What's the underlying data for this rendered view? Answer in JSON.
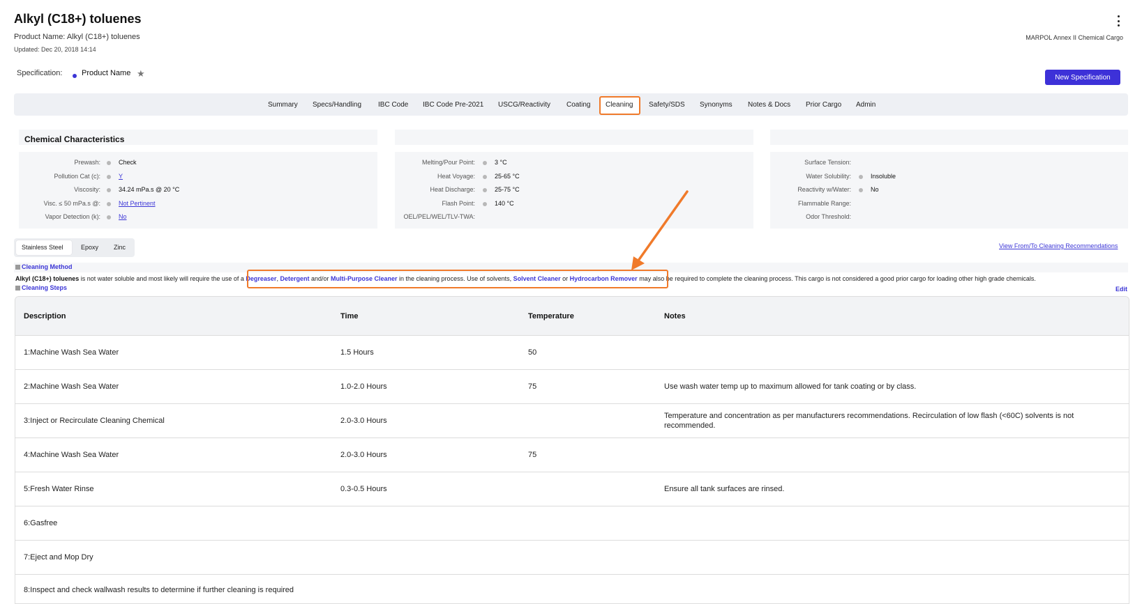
{
  "header": {
    "title": "Alkyl (C18+) toluenes",
    "product_name": "Product Name: Alkyl (C18+) toluenes",
    "updated": "Updated: Dec 20, 2018 14:14",
    "category": "MARPOL Annex II Chemical Cargo"
  },
  "specification": {
    "label": "Specification:",
    "value": "Product Name",
    "new_button": "New Specification"
  },
  "tabs": [
    "Summary",
    "Specs/Handling",
    "IBC Code",
    "IBC Code Pre-2021",
    "USCG/Reactivity",
    "Coating",
    "Cleaning",
    "Safety/SDS",
    "Synonyms",
    "Notes & Docs",
    "Prior Cargo",
    "Admin"
  ],
  "active_tab": "Cleaning",
  "chem": {
    "title": "Chemical Characteristics",
    "col1": [
      {
        "label": "Prewash:",
        "value": "Check",
        "link": false
      },
      {
        "label": "Pollution Cat (c):",
        "value": "Y",
        "link": true
      },
      {
        "label": "Viscosity:",
        "value": "34.24 mPa.s @ 20 °C",
        "link": false
      },
      {
        "label": "Visc. ≤ 50 mPa.s @:",
        "value": "Not Pertinent",
        "link": true
      },
      {
        "label": "Vapor Detection (k):",
        "value": "No",
        "link": true
      }
    ],
    "col2": [
      {
        "label": "Melting/Pour Point:",
        "value": "3 °C"
      },
      {
        "label": "Heat Voyage:",
        "value": "25-65 °C"
      },
      {
        "label": "Heat Discharge:",
        "value": "25-75 °C"
      },
      {
        "label": "Flash Point:",
        "value": "140 °C"
      },
      {
        "label": "OEL/PEL/WEL/TLV-TWA:",
        "value": ""
      }
    ],
    "col3": [
      {
        "label": "Surface Tension:",
        "value": ""
      },
      {
        "label": "Water Solubility:",
        "value": "Insoluble"
      },
      {
        "label": "Reactivity w/Water:",
        "value": "No"
      },
      {
        "label": "Flammable Range:",
        "value": ""
      },
      {
        "label": "Odor Threshold:",
        "value": ""
      }
    ]
  },
  "materials": {
    "tabs": [
      "Stainless Steel",
      "Epoxy",
      "Zinc"
    ],
    "active": "Stainless Steel",
    "view_link": "View From/To Cleaning Recommendations"
  },
  "cleaning_method": {
    "title": "Cleaning Method",
    "product": "Alkyl (C18+) toluenes",
    "t1": " is not water soluble and most likely will require the use of a ",
    "l1": "Degreaser",
    "t2": ", ",
    "l2": "Detergent",
    "t3": " and/or ",
    "l3": "Multi-Purpose Cleaner",
    "t4": " in the cleaning process. Use of solvents, ",
    "l4": "Solvent Cleaner",
    "t5": " or ",
    "l5": "Hydrocarbon Remover",
    "t6": " may also be required to complete the cleaning process. This cargo is not considered a good prior cargo for loading other high grade chemicals."
  },
  "cleaning_steps": {
    "title": "Cleaning Steps",
    "edit": "Edit",
    "headers": {
      "description": "Description",
      "time": "Time",
      "temperature": "Temperature",
      "notes": "Notes"
    },
    "rows": [
      {
        "description": "1:Machine Wash Sea Water",
        "time": "1.5 Hours",
        "temperature": "50",
        "notes": ""
      },
      {
        "description": "2:Machine Wash Sea Water",
        "time": "1.0-2.0 Hours",
        "temperature": "75",
        "notes": "Use wash water temp up to maximum allowed for tank coating or by class."
      },
      {
        "description": "3:Inject or Recirculate Cleaning Chemical",
        "time": "2.0-3.0 Hours",
        "temperature": "",
        "notes": "Temperature and concentration as per manufacturers recommendations. Recirculation of low flash (<60C) solvents is not recommended."
      },
      {
        "description": "4:Machine Wash Sea Water",
        "time": "2.0-3.0 Hours",
        "temperature": "75",
        "notes": ""
      },
      {
        "description": "5:Fresh Water Rinse",
        "time": "0.3-0.5 Hours",
        "temperature": "",
        "notes": "Ensure all tank surfaces are rinsed."
      },
      {
        "description": "6:Gasfree",
        "time": "",
        "temperature": "",
        "notes": ""
      },
      {
        "description": "7:Eject and Mop Dry",
        "time": "",
        "temperature": "",
        "notes": ""
      },
      {
        "description": "8:Inspect and check wallwash results to determine if further cleaning is required",
        "time": "",
        "temperature": "",
        "notes": ""
      }
    ]
  },
  "colors": {
    "accent": "#3d31d8",
    "highlight": "#f07a2a"
  }
}
